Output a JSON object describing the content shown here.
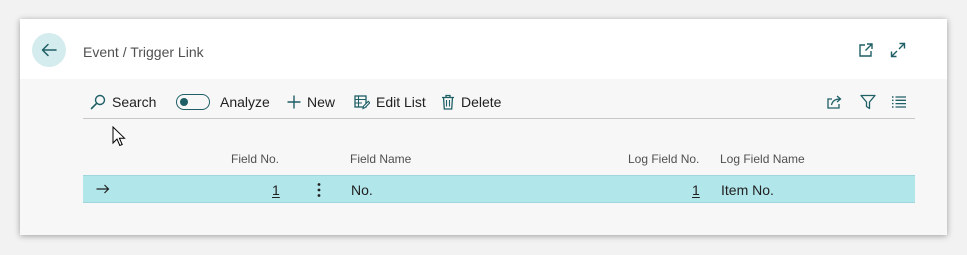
{
  "header": {
    "title": "Event / Trigger Link",
    "back_icon": "back-arrow-icon",
    "open_new_window_icon": "open-in-new-window-icon",
    "expand_icon": "expand-icon"
  },
  "toolbar": {
    "search_label": "Search",
    "analyze_label": "Analyze",
    "new_label": "New",
    "edit_list_label": "Edit List",
    "delete_label": "Delete",
    "share_icon": "share-icon",
    "filter_icon": "filter-icon",
    "list_view_icon": "list-view-icon"
  },
  "table": {
    "columns": [
      "Field No.",
      "Field Name",
      "Log Field No.",
      "Log Field Name"
    ],
    "rows": [
      {
        "field_no": "1",
        "field_name": "No.",
        "log_field_no": "1",
        "log_field_name": "Item No."
      }
    ]
  },
  "colors": {
    "accent": "#1f5f66",
    "selected_row": "#b1e6eb",
    "back_button_bg": "#d4ecee"
  }
}
